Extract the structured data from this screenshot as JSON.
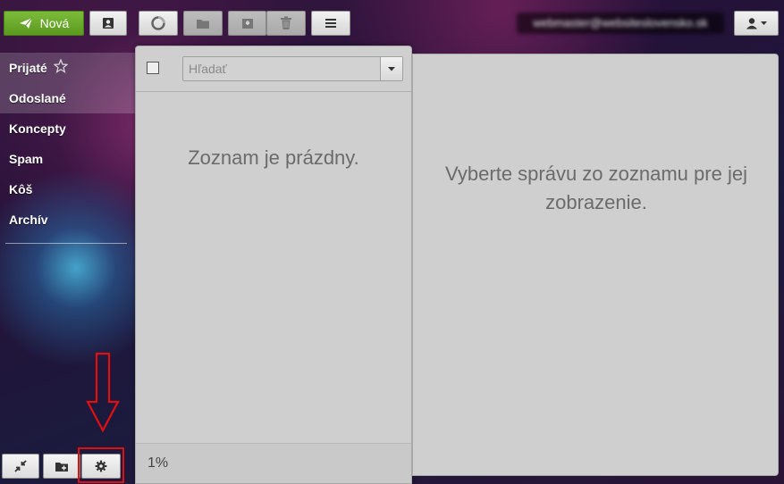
{
  "toolbar": {
    "compose_label": "Nová",
    "buttons": [
      "contacts-icon",
      "reload-icon",
      "folder-icon",
      "archive-icon",
      "trash-icon",
      "menu-icon"
    ]
  },
  "account": {
    "email": "webmaster@websiteslovensko.sk"
  },
  "folders": [
    {
      "label": "Prijaté"
    },
    {
      "label": "Odoslané"
    },
    {
      "label": "Koncepty"
    },
    {
      "label": "Spam"
    },
    {
      "label": "Kôš"
    },
    {
      "label": "Archív"
    }
  ],
  "search": {
    "placeholder": "Hľadať"
  },
  "message_list": {
    "empty_text": "Zoznam je prázdny.",
    "progress": "1%"
  },
  "viewer": {
    "empty_text": "Vyberte správu zo zoznamu pre jej zobrazenie."
  },
  "colors": {
    "compose_button": "#6aab2b",
    "panel_background": "#cfcfcf",
    "highlight_box": "#e01010",
    "arrow": "#e01010"
  }
}
